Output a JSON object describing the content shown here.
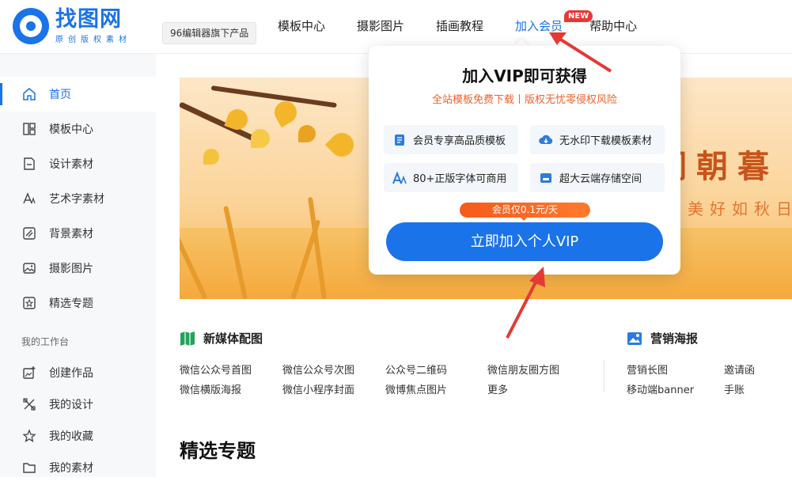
{
  "header": {
    "logo_name": "找图网",
    "logo_slogan": "原创版权素材",
    "badge": "96编辑器旗下产品",
    "nav": [
      {
        "label": "模板中心"
      },
      {
        "label": "摄影图片"
      },
      {
        "label": "插画教程"
      },
      {
        "label": "加入会员",
        "badge": "NEW"
      },
      {
        "label": "帮助中心"
      }
    ]
  },
  "sidebar": {
    "items": [
      {
        "label": "首页",
        "icon": "home-icon"
      },
      {
        "label": "模板中心",
        "icon": "template-icon"
      },
      {
        "label": "设计素材",
        "icon": "file-icon"
      },
      {
        "label": "艺术字素材",
        "icon": "font-icon"
      },
      {
        "label": "背景素材",
        "icon": "background-icon"
      },
      {
        "label": "摄影图片",
        "icon": "photo-icon"
      },
      {
        "label": "精选专题",
        "icon": "star-box-icon"
      }
    ],
    "workspace_heading": "我的工作台",
    "workspace": [
      {
        "label": "创建作品",
        "icon": "create-icon"
      },
      {
        "label": "我的设计",
        "icon": "design-icon"
      },
      {
        "label": "我的收藏",
        "icon": "star-icon"
      },
      {
        "label": "我的素材",
        "icon": "folder-icon"
      }
    ]
  },
  "banner": {
    "title": "闰朝暮",
    "subtitle": "美好如秋日"
  },
  "categories": {
    "new_media": {
      "title": "新媒体配图",
      "links": [
        "微信公众号首图",
        "微信公众号次图",
        "公众号二维码",
        "微信朋友圈方图",
        "微信横版海报",
        "微信小程序封面",
        "微博焦点图片",
        "更多"
      ]
    },
    "marketing": {
      "title": "营销海报",
      "links": [
        "营销长图",
        "邀请函",
        "移动端banner",
        "手账"
      ]
    }
  },
  "section_title": "精选专题",
  "popup": {
    "title": "加入VIP即可获得",
    "subtitle": "全站模板免费下载丨版权无忧零侵权风险",
    "features": [
      {
        "label": "会员专享高品质模板",
        "icon": "template-doc-icon"
      },
      {
        "label": "无水印下载模板素材",
        "icon": "cloud-download-icon"
      },
      {
        "label": "80+正版字体可商用",
        "icon": "font-icon"
      },
      {
        "label": "超大云端存储空间",
        "icon": "storage-icon"
      }
    ],
    "price_tag": "会员仅0.1元/天",
    "join_button": "立即加入个人VIP"
  },
  "colors": {
    "brand": "#1a73e8",
    "accent_orange": "#f55a1c",
    "new_badge": "#e53935",
    "annotation_arrow": "#e53935"
  }
}
